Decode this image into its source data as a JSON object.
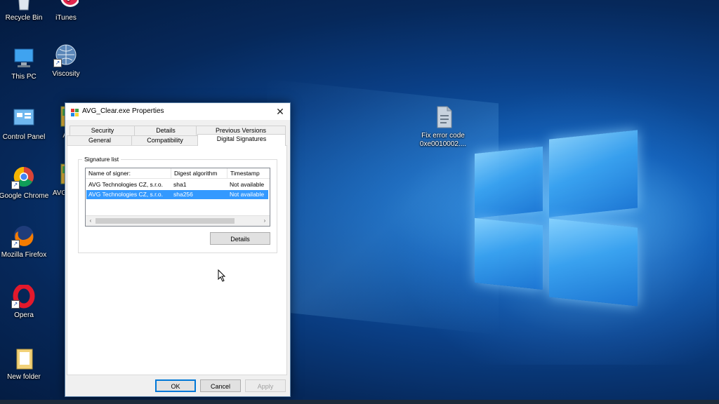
{
  "desktop": {
    "icons": [
      {
        "label": "Recycle Bin",
        "icon": "recycle-bin-icon"
      },
      {
        "label": "iTunes",
        "icon": "itunes-icon"
      },
      {
        "label": "This PC",
        "icon": "this-pc-icon"
      },
      {
        "label": "Viscosity",
        "icon": "viscosity-icon"
      },
      {
        "label": "Control Panel",
        "icon": "control-panel-icon"
      },
      {
        "label": "AV",
        "icon": "avg-icon"
      },
      {
        "label": "Google Chrome",
        "icon": "chrome-icon"
      },
      {
        "label": "AVG_C",
        "icon": "avg-icon"
      },
      {
        "label": "Mozilla Firefox",
        "icon": "firefox-icon"
      },
      {
        "label": "Opera",
        "icon": "opera-icon"
      },
      {
        "label": "New folder",
        "icon": "folder-icon"
      },
      {
        "label": "Fix error code 0xe0010002....",
        "icon": "document-icon"
      }
    ]
  },
  "dialog": {
    "title": "AVG_Clear.exe Properties",
    "close_glyph": "✕",
    "tabs_back": [
      "Security",
      "Details",
      "Previous Versions"
    ],
    "tabs_front": [
      "General",
      "Compatibility",
      "Digital Signatures"
    ],
    "active_tab": "Digital Signatures",
    "signature_list_label": "Signature list",
    "columns": [
      "Name of signer:",
      "Digest algorithm",
      "Timestamp"
    ],
    "rows": [
      {
        "signer": "AVG Technologies CZ, s.r.o.",
        "algorithm": "sha1",
        "timestamp": "Not available",
        "selected": false
      },
      {
        "signer": "AVG Technologies CZ, s.r.o.",
        "algorithm": "sha256",
        "timestamp": "Not available",
        "selected": true
      }
    ],
    "details_button": "Details",
    "ok_button": "OK",
    "cancel_button": "Cancel",
    "apply_button": "Apply"
  },
  "colors": {
    "selection": "#3399ff",
    "dialog_bg": "#f0f0f0",
    "accent": "#0078d7"
  }
}
